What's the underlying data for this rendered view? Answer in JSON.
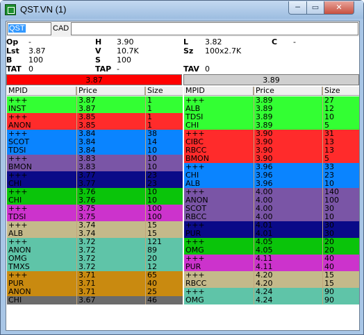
{
  "window": {
    "title": "QST.VN (1)",
    "minimize_label": "─",
    "maximize_label": "▭",
    "close_label": "✕"
  },
  "toolbar": {
    "symbol_value": "QST",
    "exchange_value": "CAD"
  },
  "summary": {
    "op_label": "Op",
    "op_value": "-",
    "h_label": "H",
    "h_value": "3.90",
    "l_label": "L",
    "l_value": "3.82",
    "c_label": "C",
    "c_value": "-",
    "lst_label": "Lst",
    "lst_value": "3.87",
    "v_label": "V",
    "v_value": "10.7K",
    "sz_label": "Sz",
    "sz_value": "100x2.7K",
    "b_label": "B",
    "b_value": "100",
    "s_label": "S",
    "s_value": "100",
    "tat_label": "TAT",
    "tat_value": "0",
    "tap_label": "TAP",
    "tap_value": "-",
    "tav_label": "TAV",
    "tav_value": "0"
  },
  "bid_price": "3.87",
  "ask_price": "3.89",
  "columns": {
    "mpid": "MPID",
    "price": "Price",
    "size": "Size"
  },
  "bids": [
    {
      "mpid": "+++",
      "price": "3.87",
      "size": "1",
      "color": "#33ff33"
    },
    {
      "mpid": "INST",
      "price": "3.87",
      "size": "1",
      "color": "#33ff33"
    },
    {
      "mpid": "+++",
      "price": "3.85",
      "size": "1",
      "color": "#ff2b2b"
    },
    {
      "mpid": "ANON",
      "price": "3.85",
      "size": "1",
      "color": "#ff2b2b"
    },
    {
      "mpid": "+++",
      "price": "3.84",
      "size": "38",
      "color": "#0a84ff"
    },
    {
      "mpid": "SCOT",
      "price": "3.84",
      "size": "14",
      "color": "#0a84ff"
    },
    {
      "mpid": "TDSI",
      "price": "3.84",
      "size": "10",
      "color": "#0a84ff"
    },
    {
      "mpid": "+++",
      "price": "3.83",
      "size": "10",
      "color": "#7a55a6"
    },
    {
      "mpid": "BMON",
      "price": "3.83",
      "size": "10",
      "color": "#7a55a6"
    },
    {
      "mpid": "+++",
      "price": "3.77",
      "size": "23",
      "color": "#0a0a88"
    },
    {
      "mpid": "CHI",
      "price": "3.77",
      "size": "23",
      "color": "#0a0a88"
    },
    {
      "mpid": "+++",
      "price": "3.76",
      "size": "10",
      "color": "#0ac40a"
    },
    {
      "mpid": "CHI",
      "price": "3.76",
      "size": "10",
      "color": "#0ac40a"
    },
    {
      "mpid": "+++",
      "price": "3.75",
      "size": "100",
      "color": "#cc33cc"
    },
    {
      "mpid": "TDSI",
      "price": "3.75",
      "size": "100",
      "color": "#cc33cc"
    },
    {
      "mpid": "+++",
      "price": "3.74",
      "size": "15",
      "color": "#c4b98a"
    },
    {
      "mpid": "ALB",
      "price": "3.74",
      "size": "15",
      "color": "#c4b98a"
    },
    {
      "mpid": "+++",
      "price": "3.72",
      "size": "121",
      "color": "#5fc4a8"
    },
    {
      "mpid": "ANON",
      "price": "3.72",
      "size": "89",
      "color": "#5fc4a8"
    },
    {
      "mpid": "OMG",
      "price": "3.72",
      "size": "20",
      "color": "#5fc4a8"
    },
    {
      "mpid": "TMXS",
      "price": "3.72",
      "size": "12",
      "color": "#5fc4a8"
    },
    {
      "mpid": "+++",
      "price": "3.71",
      "size": "65",
      "color": "#c98a10"
    },
    {
      "mpid": "PUR",
      "price": "3.71",
      "size": "40",
      "color": "#c98a10"
    },
    {
      "mpid": "ANON",
      "price": "3.71",
      "size": "25",
      "color": "#c98a10"
    },
    {
      "mpid": "CHI",
      "price": "3.67",
      "size": "46",
      "color": "#6b6b6b"
    }
  ],
  "asks": [
    {
      "mpid": "+++",
      "price": "3.89",
      "size": "27",
      "color": "#33ff33"
    },
    {
      "mpid": "ALB",
      "price": "3.89",
      "size": "12",
      "color": "#33ff33"
    },
    {
      "mpid": "TDSI",
      "price": "3.89",
      "size": "10",
      "color": "#33ff33"
    },
    {
      "mpid": "CHI",
      "price": "3.89",
      "size": "5",
      "color": "#33ff33"
    },
    {
      "mpid": "+++",
      "price": "3.90",
      "size": "31",
      "color": "#ff2b2b"
    },
    {
      "mpid": "CIBC",
      "price": "3.90",
      "size": "13",
      "color": "#ff2b2b"
    },
    {
      "mpid": "RBCC",
      "price": "3.90",
      "size": "13",
      "color": "#ff2b2b"
    },
    {
      "mpid": "BMON",
      "price": "3.90",
      "size": "5",
      "color": "#ff2b2b"
    },
    {
      "mpid": "+++",
      "price": "3.96",
      "size": "33",
      "color": "#0a84ff"
    },
    {
      "mpid": "CHI",
      "price": "3.96",
      "size": "23",
      "color": "#0a84ff"
    },
    {
      "mpid": "ALB",
      "price": "3.96",
      "size": "10",
      "color": "#0a84ff"
    },
    {
      "mpid": "+++",
      "price": "4.00",
      "size": "140",
      "color": "#7a55a6"
    },
    {
      "mpid": "ANON",
      "price": "4.00",
      "size": "100",
      "color": "#7a55a6"
    },
    {
      "mpid": "SCOT",
      "price": "4.00",
      "size": "30",
      "color": "#7a55a6"
    },
    {
      "mpid": "RBCC",
      "price": "4.00",
      "size": "10",
      "color": "#7a55a6"
    },
    {
      "mpid": "+++",
      "price": "4.01",
      "size": "30",
      "color": "#0a0a88"
    },
    {
      "mpid": "PUR",
      "price": "4.01",
      "size": "30",
      "color": "#0a0a88"
    },
    {
      "mpid": "+++",
      "price": "4.05",
      "size": "20",
      "color": "#0ac40a"
    },
    {
      "mpid": "OMG",
      "price": "4.05",
      "size": "20",
      "color": "#0ac40a"
    },
    {
      "mpid": "+++",
      "price": "4.11",
      "size": "40",
      "color": "#cc33cc"
    },
    {
      "mpid": "PUR",
      "price": "4.11",
      "size": "40",
      "color": "#cc33cc"
    },
    {
      "mpid": "+++",
      "price": "4.20",
      "size": "15",
      "color": "#c4b98a"
    },
    {
      "mpid": "RBCC",
      "price": "4.20",
      "size": "15",
      "color": "#c4b98a"
    },
    {
      "mpid": "+++",
      "price": "4.24",
      "size": "90",
      "color": "#5fc4a8"
    },
    {
      "mpid": "OMG",
      "price": "4.24",
      "size": "90",
      "color": "#5fc4a8"
    }
  ]
}
